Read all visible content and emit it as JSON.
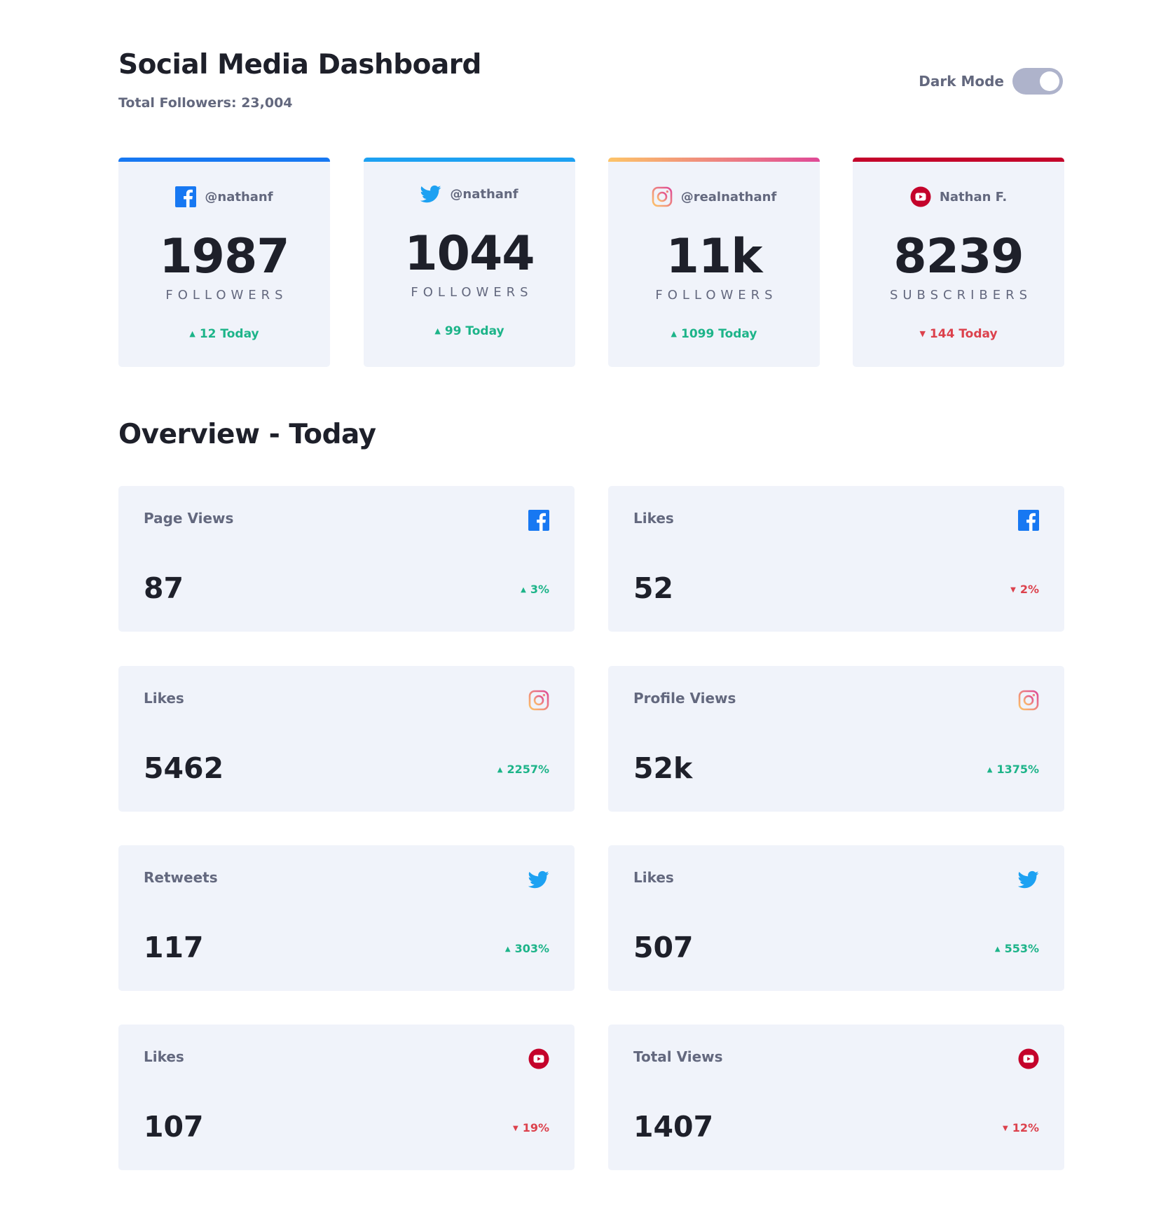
{
  "header": {
    "title": "Social Media Dashboard",
    "total_followers": "Total Followers: 23,004",
    "dark_mode_label": "Dark Mode",
    "dark_mode_on": false
  },
  "colors": {
    "facebook": "#1778f2",
    "twitter": "#1da1f2",
    "instagram_gradient": [
      "#fdc468",
      "#df4996"
    ],
    "youtube": "#c4032b",
    "up": "#1db489",
    "down": "#dc414c",
    "card_bg": "#f0f3fa",
    "text_primary": "#1e202a",
    "text_secondary": "#63687e",
    "toggle_track": "#aeb3cb"
  },
  "followers": [
    {
      "platform": "facebook",
      "icon": "facebook-icon",
      "handle": "@nathanf",
      "count": "1987",
      "unit": "FOLLOWERS",
      "today": "12 Today",
      "trend": "up",
      "arrow": "▲"
    },
    {
      "platform": "twitter",
      "icon": "twitter-icon",
      "handle": "@nathanf",
      "count": "1044",
      "unit": "FOLLOWERS",
      "today": "99 Today",
      "trend": "up",
      "arrow": "▲"
    },
    {
      "platform": "instagram",
      "icon": "instagram-icon",
      "handle": "@realnathanf",
      "count": "11k",
      "unit": "FOLLOWERS",
      "today": "1099 Today",
      "trend": "up",
      "arrow": "▲"
    },
    {
      "platform": "youtube",
      "icon": "youtube-icon",
      "handle": "Nathan F.",
      "count": "8239",
      "unit": "SUBSCRIBERS",
      "today": "144 Today",
      "trend": "down",
      "arrow": "▼"
    }
  ],
  "overview": {
    "title": "Overview - Today",
    "items": [
      {
        "label": "Page Views",
        "platform": "facebook",
        "icon": "facebook-icon",
        "value": "87",
        "change": "3%",
        "trend": "up",
        "arrow": "▲"
      },
      {
        "label": "Likes",
        "platform": "facebook",
        "icon": "facebook-icon",
        "value": "52",
        "change": "2%",
        "trend": "down",
        "arrow": "▼"
      },
      {
        "label": "Likes",
        "platform": "instagram",
        "icon": "instagram-icon",
        "value": "5462",
        "change": "2257%",
        "trend": "up",
        "arrow": "▲"
      },
      {
        "label": "Profile Views",
        "platform": "instagram",
        "icon": "instagram-icon",
        "value": "52k",
        "change": "1375%",
        "trend": "up",
        "arrow": "▲"
      },
      {
        "label": "Retweets",
        "platform": "twitter",
        "icon": "twitter-icon",
        "value": "117",
        "change": "303%",
        "trend": "up",
        "arrow": "▲"
      },
      {
        "label": "Likes",
        "platform": "twitter",
        "icon": "twitter-icon",
        "value": "507",
        "change": "553%",
        "trend": "up",
        "arrow": "▲"
      },
      {
        "label": "Likes",
        "platform": "youtube",
        "icon": "youtube-icon",
        "value": "107",
        "change": "19%",
        "trend": "down",
        "arrow": "▼"
      },
      {
        "label": "Total Views",
        "platform": "youtube",
        "icon": "youtube-icon",
        "value": "1407",
        "change": "12%",
        "trend": "down",
        "arrow": "▼"
      }
    ]
  }
}
